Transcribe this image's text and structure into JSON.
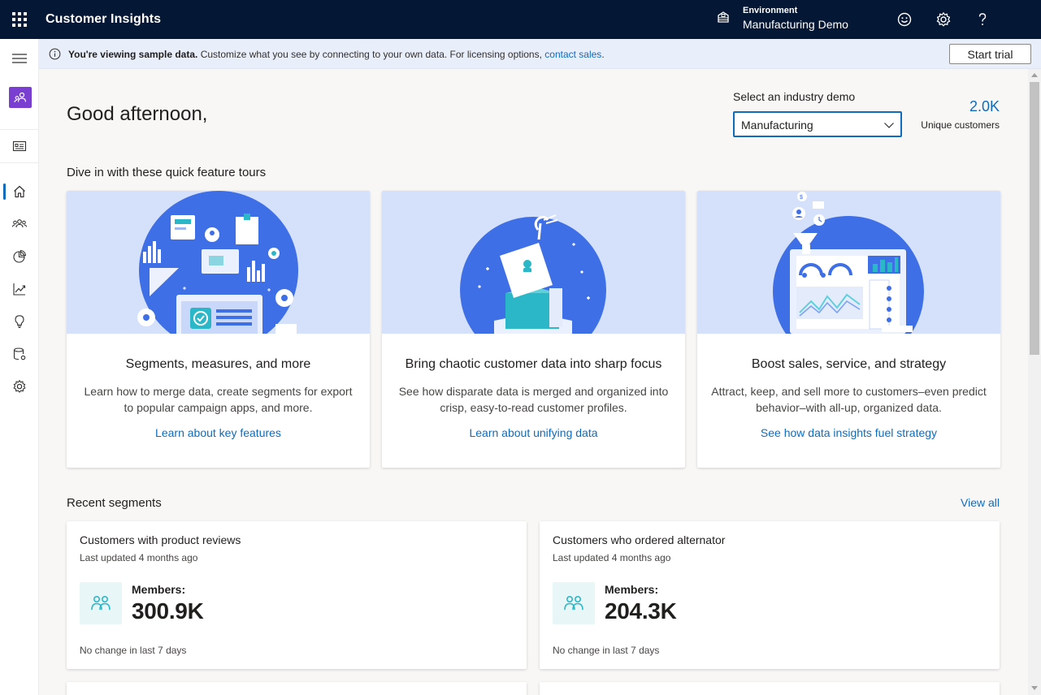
{
  "topbar": {
    "app_title": "Customer Insights",
    "environment_label": "Environment",
    "environment_value": "Manufacturing Demo",
    "background": "#041734"
  },
  "infobar": {
    "bold_text": "You're viewing sample data.",
    "text": " Customize what you see by connecting to your own data. For licensing options, ",
    "link_text": "contact sales",
    "trailing": ".",
    "button_label": "Start trial"
  },
  "nav": {
    "items": [
      {
        "name": "home",
        "icon": "home-icon",
        "active": true
      },
      {
        "name": "customers",
        "icon": "people-icon"
      },
      {
        "name": "segments",
        "icon": "pie-chart-icon"
      },
      {
        "name": "measures",
        "icon": "trend-icon"
      },
      {
        "name": "insights",
        "icon": "lightbulb-icon"
      },
      {
        "name": "data",
        "icon": "database-gear-icon"
      },
      {
        "name": "settings",
        "icon": "gear-icon"
      }
    ]
  },
  "main": {
    "greeting": "Good afternoon,",
    "industry_select": {
      "label": "Select an industry demo",
      "value": "Manufacturing"
    },
    "unique_customers": {
      "value": "2.0K",
      "label": "Unique customers"
    },
    "tours_title": "Dive in with these quick feature tours",
    "tours": [
      {
        "title": "Segments, measures, and more",
        "description": "Learn how to merge data, create segments for export to popular campaign apps, and more.",
        "link": "Learn about key features"
      },
      {
        "title": "Bring chaotic customer data into sharp focus",
        "description": "See how disparate data is merged and organized into crisp, easy-to-read customer profiles.",
        "link": "Learn about unifying data"
      },
      {
        "title": "Boost sales, service, and strategy",
        "description": "Attract, keep, and sell more to customers–even predict behavior–with all-up, organized data.",
        "link": "See how data insights fuel strategy"
      }
    ],
    "segments_title": "Recent segments",
    "view_all": "View all",
    "segments": [
      {
        "name": "Customers with product reviews",
        "updated": "Last updated 4 months ago",
        "members_label": "Members:",
        "members": "300.9K",
        "change": "No change in last 7 days"
      },
      {
        "name": "Customers who ordered alternator",
        "updated": "Last updated 4 months ago",
        "members_label": "Members:",
        "members": "204.3K",
        "change": "No change in last 7 days"
      }
    ]
  },
  "colors": {
    "accent": "#0f6cbd",
    "hero_bg": "#d5e1fb",
    "hero_circle": "#3f6fe6",
    "rail_badge": "#7a3fd1",
    "segment_icon": "#2bb7c7"
  }
}
